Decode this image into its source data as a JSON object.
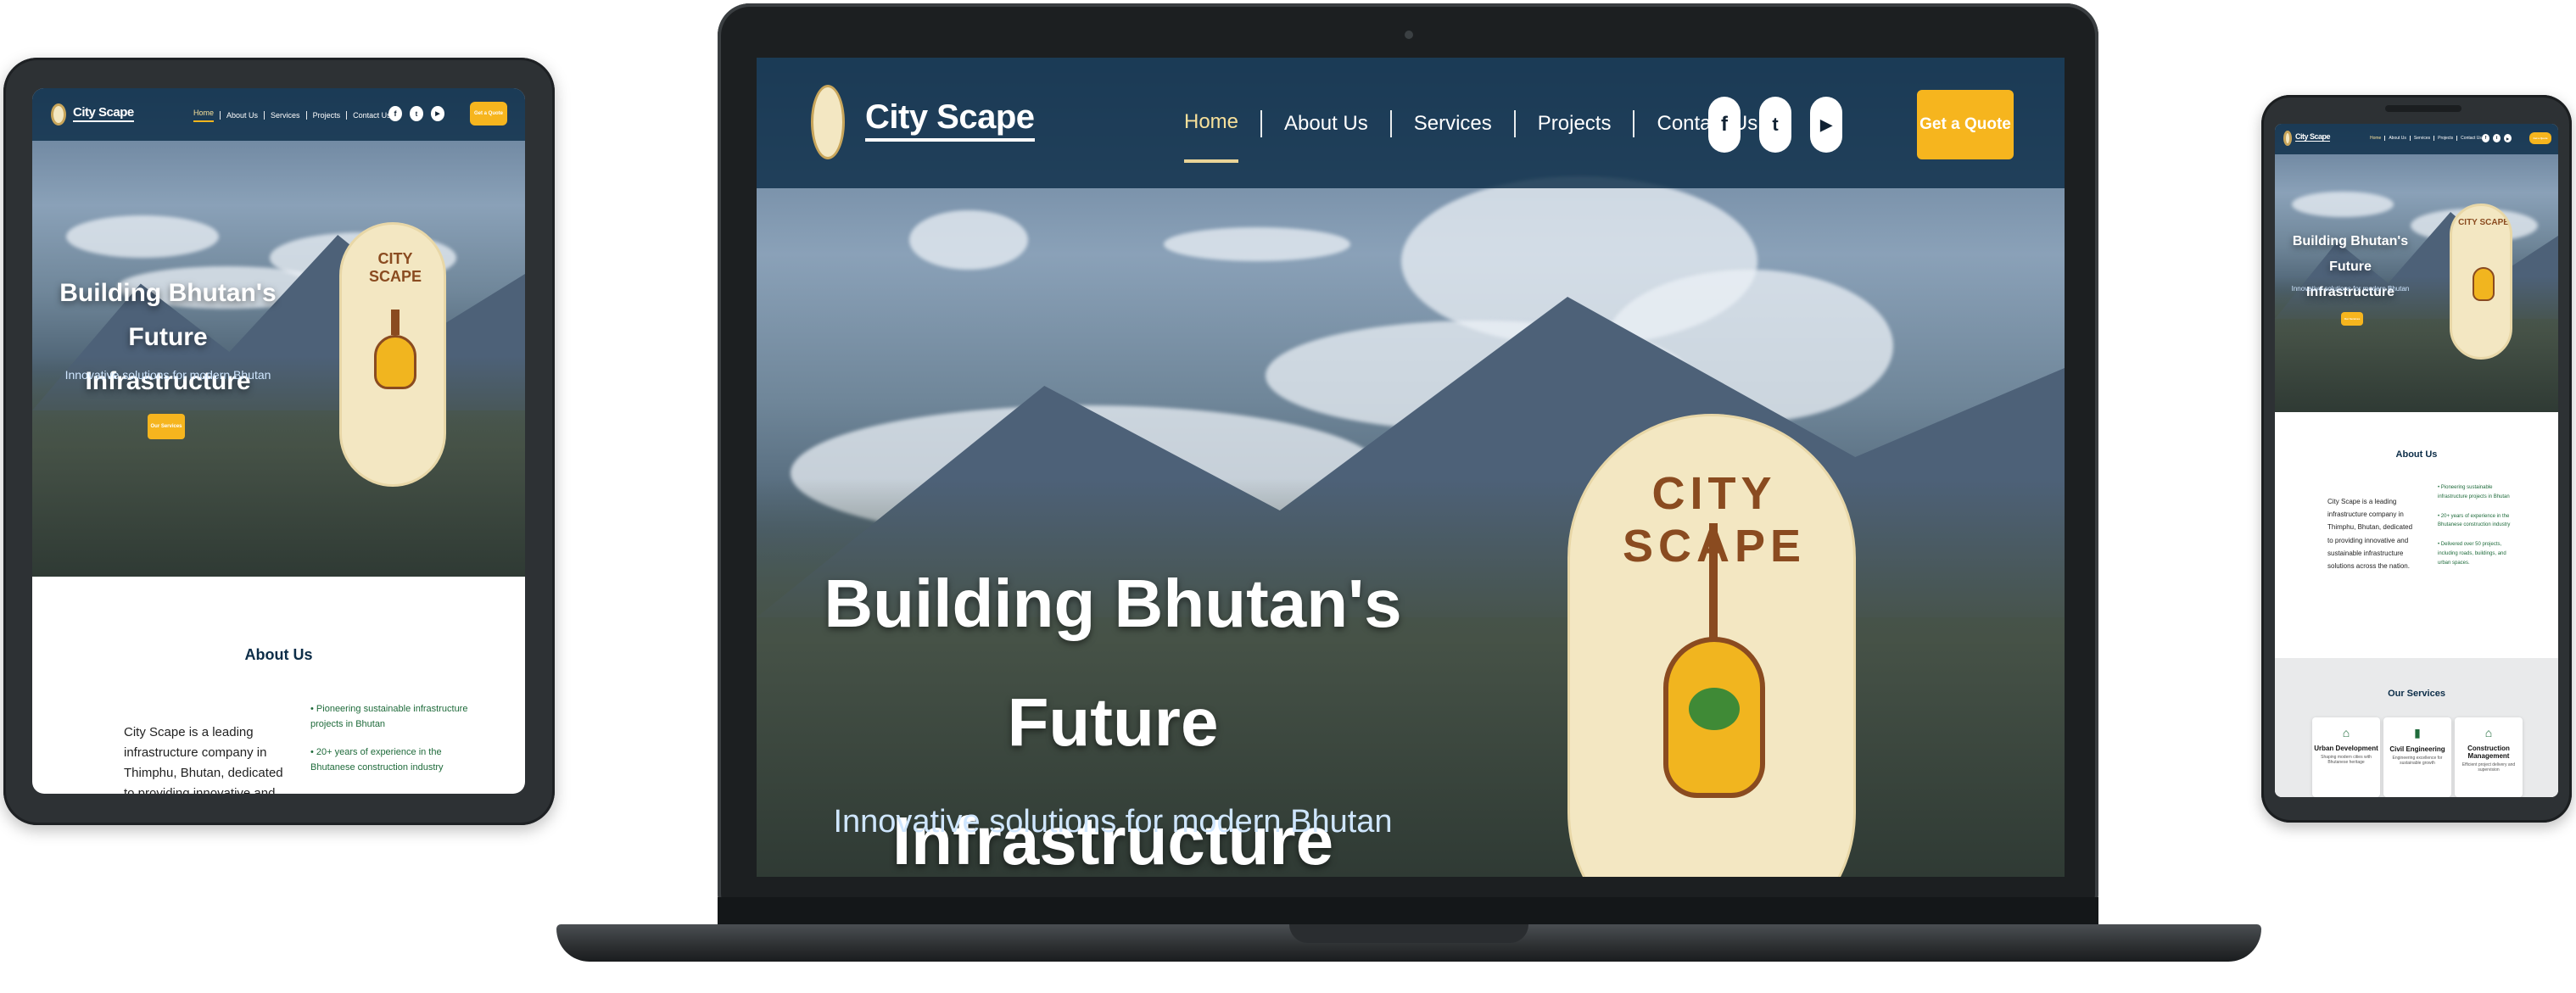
{
  "brand": {
    "name": "City Scape",
    "emblem_text": "CITY SCAPE",
    "emblem_subtext": "BUILDING BHUTAN'S FUTURE"
  },
  "nav": {
    "items": [
      "Home",
      "About Us",
      "Services",
      "Projects",
      "Contact Us"
    ],
    "active": "Home",
    "quote_button": "Get a Quote"
  },
  "social": [
    "facebook-icon",
    "twitter-icon",
    "youtube-icon"
  ],
  "hero": {
    "title_line1": "Building Bhutan's Future",
    "title_line2": "Infrastructure",
    "subtitle": "Innovative solutions for modern Bhutan",
    "cta": "Our Services"
  },
  "about": {
    "title": "About Us",
    "paragraph": "City Scape is a leading infrastructure company in Thimphu, Bhutan, dedicated to providing innovative and sustainable infrastructure solutions across the nation.",
    "bullets": [
      "Pioneering sustainable infrastructure projects in Bhutan",
      "20+ years of experience in the Bhutanese construction industry",
      "Delivered over 50 projects, including roads, buildings, and urban spaces."
    ]
  },
  "services": {
    "title": "Our Services",
    "cards": [
      {
        "name": "Urban Development",
        "desc": "Shaping modern cities with Bhutanese heritage",
        "icon": "building-icon"
      },
      {
        "name": "Civil Engineering",
        "desc": "Engineering excellence for sustainable growth",
        "icon": "tower-icon"
      },
      {
        "name": "Construction Management",
        "desc": "Efficient project delivery and supervision",
        "icon": "house-icon"
      }
    ]
  },
  "colors": {
    "navy": "#0c2d48",
    "accent": "#f6b51e",
    "green": "#1f6b3b",
    "cream": "#f3e7c2"
  }
}
